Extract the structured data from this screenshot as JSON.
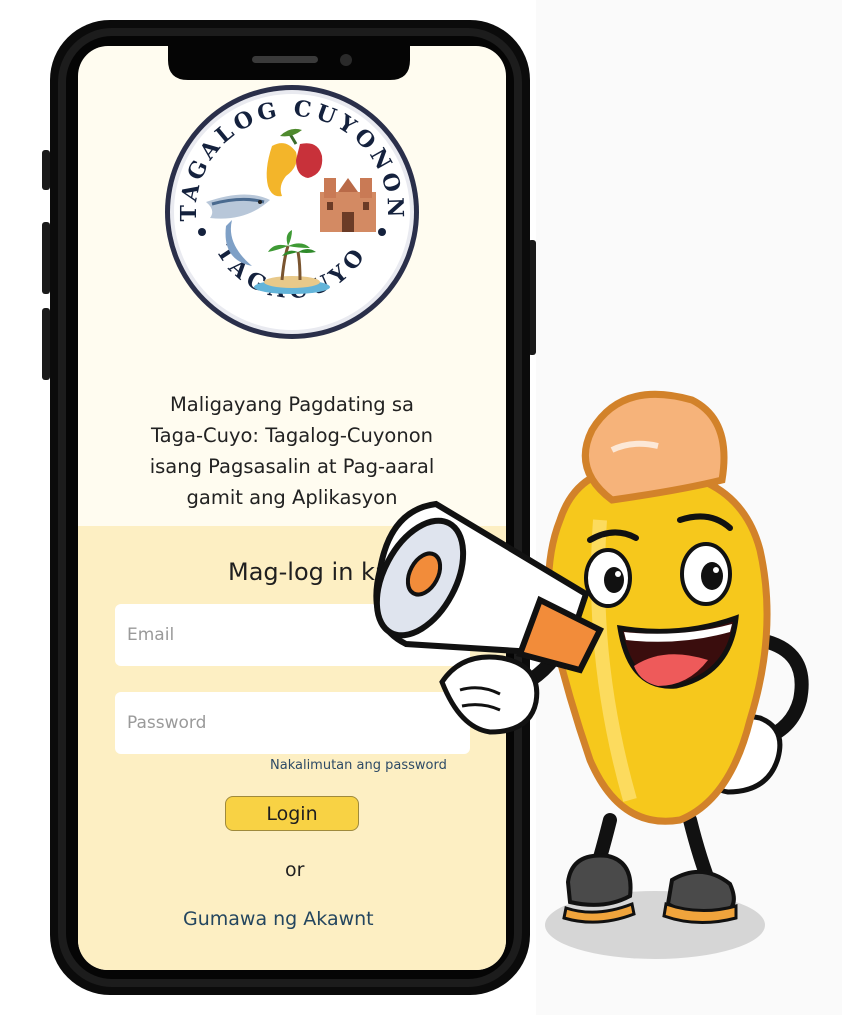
{
  "logo": {
    "top_text": "TAGALOG CUYONON",
    "bottom_text": "TAGACUYO"
  },
  "welcome": {
    "line1": "Maligayang Pagdating sa",
    "line2": "Taga-Cuyo: Tagalog-Cuyonon",
    "line3": "isang Pagsasalin at Pag-aaral",
    "line4": "gamit ang Aplikasyon"
  },
  "login": {
    "title": "Mag-log in ka",
    "email_placeholder": "Email",
    "password_placeholder": "Password",
    "forgot_link": "Nakalimutan ang password",
    "button_label": "Login",
    "or_text": "or",
    "create_account": "Gumawa ng Akawnt"
  },
  "colors": {
    "phone_frame": "#0b0b0b",
    "screen_top": "#fffcf0",
    "screen_bottom": "#fdefc3",
    "button": "#f8d244",
    "link": "#24465f",
    "mascot_body": "#f6c81c"
  }
}
